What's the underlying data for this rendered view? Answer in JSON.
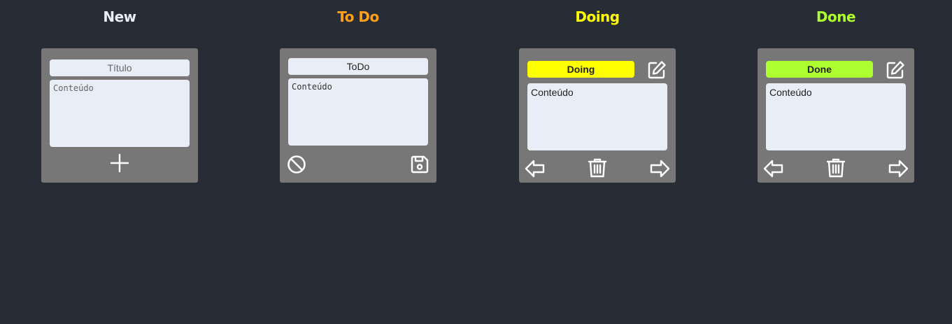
{
  "columns": [
    {
      "title": "New",
      "color": "#e9eef6"
    },
    {
      "title": "To Do",
      "color": "#ff9f1a"
    },
    {
      "title": "Doing",
      "color": "#ffff00"
    },
    {
      "title": "Done",
      "color": "#adff2f"
    }
  ],
  "new_card": {
    "title_placeholder": "Título",
    "content_placeholder": "Conteúdo",
    "add_icon": "plus-icon"
  },
  "todo_card": {
    "title": "ToDo",
    "content": "Conteúdo",
    "cancel_icon": "cancel-icon",
    "save_icon": "save-icon"
  },
  "doing_card": {
    "title": "Doing",
    "badge_color": "#ffff00",
    "content": "Conteúdo",
    "icons": [
      "edit-icon",
      "arrow-left-icon",
      "trash-icon",
      "arrow-right-icon"
    ]
  },
  "done_card": {
    "title": "Done",
    "badge_color": "#adff2f",
    "content": "Conteúdo",
    "icons": [
      "edit-icon",
      "arrow-left-icon",
      "trash-icon",
      "arrow-right-icon"
    ]
  }
}
